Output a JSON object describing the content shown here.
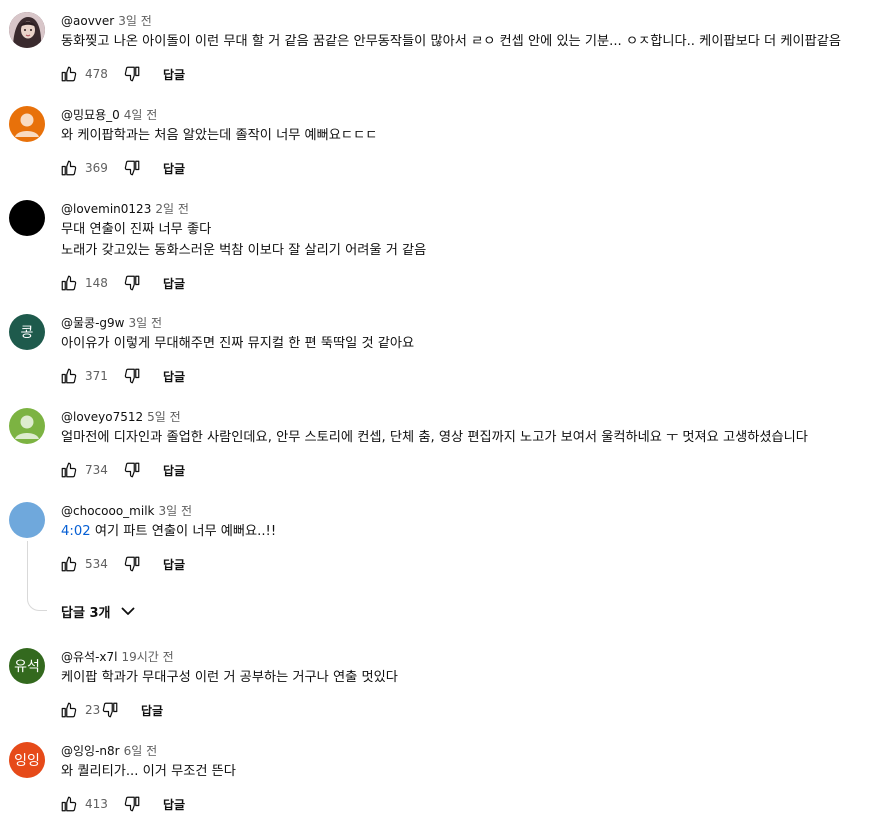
{
  "comments": [
    {
      "author": "@aovver",
      "time": "3일 전",
      "lines": [
        "동화찢고 나온 아이돌이 이런 무대 할 거 같음 꿈같은 안무동작들이 많아서 ㄹㅇ 컨셉 안에 있는 기분... ㅇㅈ합니다.. 케이팝보다 더 케이팝같음"
      ],
      "likes": "478",
      "reply_label": "답글",
      "avatar": {
        "type": "photo",
        "color": "#6b4a55"
      }
    },
    {
      "author": "@밍묘용_0",
      "time": "4일 전",
      "lines": [
        "와 케이팝학과는 처음 알았는데 졸작이 너무 예뻐요ㄷㄷㄷ"
      ],
      "likes": "369",
      "reply_label": "답글",
      "avatar": {
        "type": "default",
        "color": "#e8710a"
      }
    },
    {
      "author": "@lovemin0123",
      "time": "2일 전",
      "lines": [
        "무대 연출이 진짜 너무 좋다",
        "노래가 갖고있는 동화스러운 벅참 이보다 잘 살리기 어려울 거 같음"
      ],
      "likes": "148",
      "reply_label": "답글",
      "avatar": {
        "type": "solid",
        "color": "#000000"
      }
    },
    {
      "author": "@물콩-g9w",
      "time": "3일 전",
      "lines": [
        "아이유가 이렇게 무대해주면 진짜 뮤지컬 한 편 뚝딱일 것 같아요"
      ],
      "likes": "371",
      "reply_label": "답글",
      "avatar": {
        "type": "letter",
        "letter": "콩",
        "color": "#1e5a4c"
      }
    },
    {
      "author": "@loveyo7512",
      "time": "5일 전",
      "lines": [
        "얼마전에 디자인과 졸업한 사람인데요, 안무 스토리에 컨셉, 단체 춤, 영상 편집까지 노고가 보여서 울컥하네요 ㅜ 멋져요 고생하셨습니다"
      ],
      "likes": "734",
      "reply_label": "답글",
      "avatar": {
        "type": "default",
        "color": "#7cb342"
      }
    },
    {
      "author": "@chocooo_milk",
      "time": "3일 전",
      "timestamp": "4:02",
      "lines": [
        "여기 파트 연출이 너무 예뻐요..!!"
      ],
      "likes": "534",
      "reply_label": "답글",
      "avatar": {
        "type": "solid",
        "color": "#6fa8dc"
      }
    },
    {
      "author": "@유석-x7l",
      "time": "19시간 전",
      "lines": [
        "케이팝 학과가 무대구성 이런 거 공부하는 거구나 연출 멋있다"
      ],
      "likes": "23",
      "reply_label": "답글",
      "avatar": {
        "type": "letter",
        "letter": "유석",
        "color": "#33691e"
      }
    },
    {
      "author": "@잉잉-n8r",
      "time": "6일 전",
      "lines": [
        "와 퀄리티가... 이거 무조건 뜬다"
      ],
      "likes": "413",
      "reply_label": "답글",
      "avatar": {
        "type": "letter",
        "letter": "잉잉",
        "color": "#e64a19"
      }
    }
  ],
  "replies_toggle": {
    "label": "답글 3개"
  },
  "icons": {
    "like": "thumbs-up-icon",
    "dislike": "thumbs-down-icon",
    "expand": "chevron-down-icon"
  }
}
